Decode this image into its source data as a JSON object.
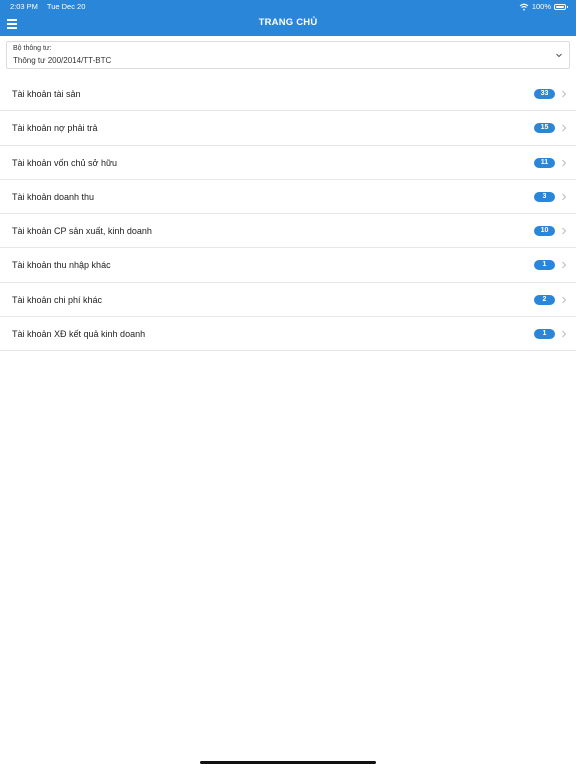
{
  "status": {
    "time": "2:03 PM",
    "date": "Tue Dec 20",
    "battery": "100%"
  },
  "header": {
    "title": "TRANG CHỦ"
  },
  "selector": {
    "label": "Bộ thông tư:",
    "value": "Thông tư 200/2014/TT-BTC"
  },
  "accounts": [
    {
      "label": "Tài khoản tài sản",
      "count": "33"
    },
    {
      "label": "Tài khoản nợ phải trả",
      "count": "15"
    },
    {
      "label": "Tài khoản vốn chủ sở hữu",
      "count": "11"
    },
    {
      "label": "Tài khoản doanh thu",
      "count": "3"
    },
    {
      "label": "Tài khoản CP sản xuất, kinh doanh",
      "count": "10"
    },
    {
      "label": "Tài khoản thu nhập khác",
      "count": "1"
    },
    {
      "label": "Tài khoản chi phí khác",
      "count": "2"
    },
    {
      "label": "Tài khoản XĐ kết quả kinh doanh",
      "count": "1"
    }
  ],
  "colors": {
    "accent": "#2a86d8"
  }
}
